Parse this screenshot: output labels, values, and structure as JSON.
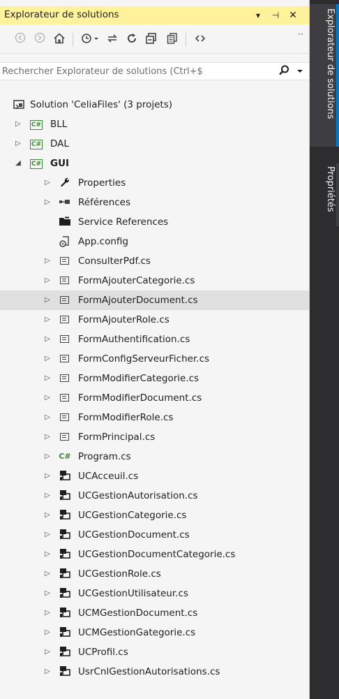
{
  "panel": {
    "title": "Explorateur de solutions",
    "title_buttons": {
      "dropdown": "▾",
      "pin": "⊣",
      "close": "✕"
    }
  },
  "toolbar": {
    "back_icon": "back-arrow-icon",
    "forward_icon": "forward-arrow-icon",
    "home_icon": "home-icon",
    "pending_changes_icon": "history-dropdown-icon",
    "sync_icon": "sync-with-active-document-icon",
    "refresh_icon": "refresh-icon",
    "collapse_all_icon": "collapse-all-icon",
    "show_all_files_icon": "show-all-files-icon",
    "view_code_icon": "view-code-icon",
    "overflow_label": "⋅⋅"
  },
  "search": {
    "placeholder": "Rechercher Explorateur de solutions (Ctrl+$"
  },
  "tree": {
    "solution": "Solution 'CeliaFiles' (3 projets)",
    "projects": [
      "BLL",
      "DAL",
      "GUI"
    ],
    "gui_items": [
      "Properties",
      "Références",
      "Service References",
      "App.config",
      "ConsulterPdf.cs",
      "FormAjouterCategorie.cs",
      "FormAjouterDocument.cs",
      "FormAjouterRole.cs",
      "FormAuthentification.cs",
      "FormConfigServeurFicher.cs",
      "FormModifierCategorie.cs",
      "FormModifierDocument.cs",
      "FormModifierRole.cs",
      "FormPrincipal.cs",
      "Program.cs",
      "UCAcceuil.cs",
      "UCGestionAutorisation.cs",
      "UCGestionCategorie.cs",
      "UCGestionDocument.cs",
      "UCGestionDocumentCategorie.cs",
      "UCGestionRole.cs",
      "UCGestionUtilisateur.cs",
      "UCMGestionDocument.cs",
      "UCMGestionGategorie.cs",
      "UCProfil.cs",
      "UsrCnlGestionAutorisations.cs"
    ],
    "selected_item": "FormAjouterDocument.cs",
    "badge_cs": "C#"
  },
  "sidebar": {
    "tabs": [
      "Explorateur de solutions",
      "Propriétés"
    ]
  },
  "colors": {
    "title_bg": "#FFF29D",
    "panel_bg": "#F5F5F5",
    "selected_row": "#E0E0E0",
    "sidebar_bg": "#2D2D30",
    "accent": "#007ACC",
    "cs_green": "#388A34"
  }
}
